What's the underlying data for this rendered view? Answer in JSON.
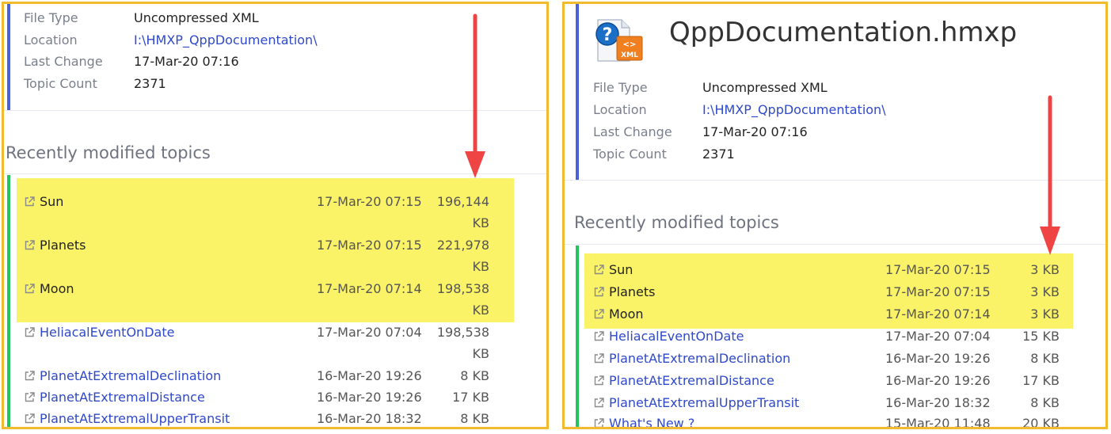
{
  "properties": {
    "labels": [
      "File Type",
      "Location",
      "Last Change",
      "Topic Count"
    ],
    "file_type": "Uncompressed XML",
    "location": "I:\\HMXP_QppDocumentation\\",
    "last_change": "17-Mar-20 07:16",
    "topic_count": "2371"
  },
  "right_header": {
    "title": "QppDocumentation.hmxp",
    "icon_badge": "XML",
    "icon": "xml-project-file-icon"
  },
  "section_title": "Recently modified topics",
  "left_topics": [
    {
      "name": "Sun",
      "date": "17-Mar-20 07:15",
      "size_num": "196,144",
      "size_unit": "KB",
      "highlighted": true
    },
    {
      "name": "Planets",
      "date": "17-Mar-20 07:15",
      "size_num": "221,978",
      "size_unit": "KB",
      "highlighted": true
    },
    {
      "name": "Moon",
      "date": "17-Mar-20 07:14",
      "size_num": "198,538",
      "size_unit": "KB",
      "highlighted": true
    },
    {
      "name": "HeliacalEventOnDate",
      "date": "17-Mar-20 07:04",
      "size_num": "198,538",
      "size_unit": "KB",
      "highlighted": false
    },
    {
      "name": "PlanetAtExtremalDeclination",
      "date": "16-Mar-20 19:26",
      "size": "8 KB",
      "highlighted": false
    },
    {
      "name": "PlanetAtExtremalDistance",
      "date": "16-Mar-20 19:26",
      "size": "17 KB",
      "highlighted": false
    },
    {
      "name": "PlanetAtExtremalUpperTransit",
      "date": "16-Mar-20 18:32",
      "size": "8 KB",
      "highlighted": false
    }
  ],
  "right_topics": [
    {
      "name": "Sun",
      "date": "17-Mar-20 07:15",
      "size": "3 KB",
      "highlighted": true
    },
    {
      "name": "Planets",
      "date": "17-Mar-20 07:15",
      "size": "3 KB",
      "highlighted": true
    },
    {
      "name": "Moon",
      "date": "17-Mar-20 07:14",
      "size": "3 KB",
      "highlighted": true
    },
    {
      "name": "HeliacalEventOnDate",
      "date": "17-Mar-20 07:04",
      "size": "15 KB",
      "highlighted": false
    },
    {
      "name": "PlanetAtExtremalDeclination",
      "date": "16-Mar-20 19:26",
      "size": "8 KB",
      "highlighted": false
    },
    {
      "name": "PlanetAtExtremalDistance",
      "date": "16-Mar-20 19:26",
      "size": "17 KB",
      "highlighted": false
    },
    {
      "name": "PlanetAtExtremalUpperTransit",
      "date": "16-Mar-20 18:32",
      "size": "8 KB",
      "highlighted": false
    },
    {
      "name": "What's New ?",
      "date": "15-Mar-20 11:48",
      "size": "20 KB",
      "highlighted": false
    }
  ],
  "colors": {
    "frame_border": "#f2bb2f",
    "highlight": "#fbf367",
    "link": "#2f49c9",
    "arrow": "#ef4444",
    "info_bar": "#4a62d6",
    "list_bar": "#22c55e"
  },
  "icons": {
    "topic_link": "external-link-icon",
    "annotation": "red-down-arrow"
  }
}
